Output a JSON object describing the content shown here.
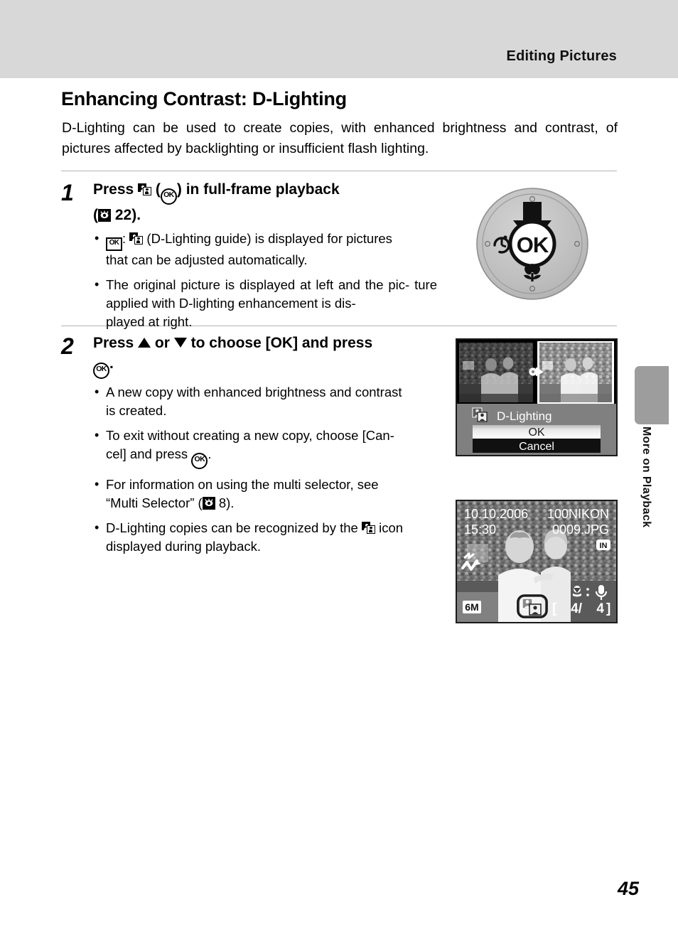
{
  "header": {
    "running_title": "Editing Pictures"
  },
  "page": {
    "title": "Enhancing Contrast: D-Lighting",
    "intro": "D-Lighting can be used to create copies, with enhanced brightness and contrast, of pictures affected by backlighting or insufficient flash lighting.",
    "number": "45"
  },
  "side_tab": {
    "label": "More on Playback"
  },
  "steps": [
    {
      "number": "1",
      "head_part1": "Press",
      "head_icon1": "d-lighting-icon",
      "head_part2": "(",
      "head_icon2": "ok-button-round-icon",
      "head_part3": ") in full-frame playback (",
      "head_icon3": "reference-eye-icon",
      "head_part4": "22).",
      "head_text_a": "Press",
      "head_text_b": ") in",
      "head_text_c": "full-frame",
      "head_text_d": "playback",
      "head_text_e": "22).",
      "bullets": [
        {
          "icon": "ok-button-square-icon",
          "text_a": ":",
          "icon2": "d-lighting-icon",
          "text_b": "(D-Lighting guide) is displayed for pictures",
          "text_c": "that can be adjusted automatically."
        },
        {
          "text_a": "The original picture is displayed at left and the pic-",
          "text_b": "ture applied with D-lighting enhancement is dis-",
          "text_c": "played at right."
        }
      ]
    },
    {
      "number": "2",
      "head_text_a": "Press",
      "head_text_b": "or",
      "head_text_c": "to choose [OK] and press",
      "head_text_d": ".",
      "head_icon_up": "triangle-up-icon",
      "head_icon_down": "triangle-down-icon",
      "head_icon_ok": "ok-button-round-icon",
      "bullets": [
        {
          "text_a": "A new copy with enhanced brightness and contrast",
          "text_b": "is created."
        },
        {
          "text_a": "To exit without creating a new copy, choose [Can-",
          "text_b": "cel] and press",
          "text_c": ".",
          "icon": "ok-button-round-icon"
        },
        {
          "text_a": "For information on using the multi selector, see",
          "text_b": "“Multi Selector” (",
          "text_c": "8).",
          "icon": "reference-eye-icon"
        },
        {
          "text_a": "D-Lighting copies can be recognized by the",
          "text_b": "icon",
          "text_c": "displayed during playback.",
          "icon": "d-lighting-icon"
        }
      ]
    }
  ],
  "dial_illustration": {
    "name": "multi-selector-dial",
    "center_label": "OK",
    "icons": [
      "self-timer-icon",
      "macro-flower-icon",
      "down-arrow-indicator"
    ]
  },
  "dlight_screen": {
    "menu_title": "D-Lighting",
    "menu_icon": "d-lighting-icon",
    "options": [
      {
        "label": "OK",
        "selected": true
      },
      {
        "label": "Cancel",
        "selected": false
      }
    ],
    "left_thumb_caption": "original-picture",
    "right_thumb_caption": "enhanced-picture"
  },
  "playback_screen": {
    "date": "10.10.2006",
    "time": "15:30",
    "folder": "100NIKON",
    "filename": "0009.JPG",
    "memory_badge": "IN",
    "image_size_badge": "6M",
    "dlight_badge": "d-lighting-icon",
    "frame_counter_open": "[",
    "frame_current": "4/",
    "frame_total": "4",
    "frame_counter_close": "]",
    "icons": [
      "dlighting-level-icon",
      "transfer-mark-icon",
      "voice-memo-mic-icon"
    ]
  },
  "colors": {
    "header_band": "#d8d8d8",
    "rule": "#b4b4b4",
    "side_tab": "#9d9d9d",
    "screen_panel": "#808080",
    "selected_row": "#f2f2f2",
    "unselected_row": "#101010"
  }
}
